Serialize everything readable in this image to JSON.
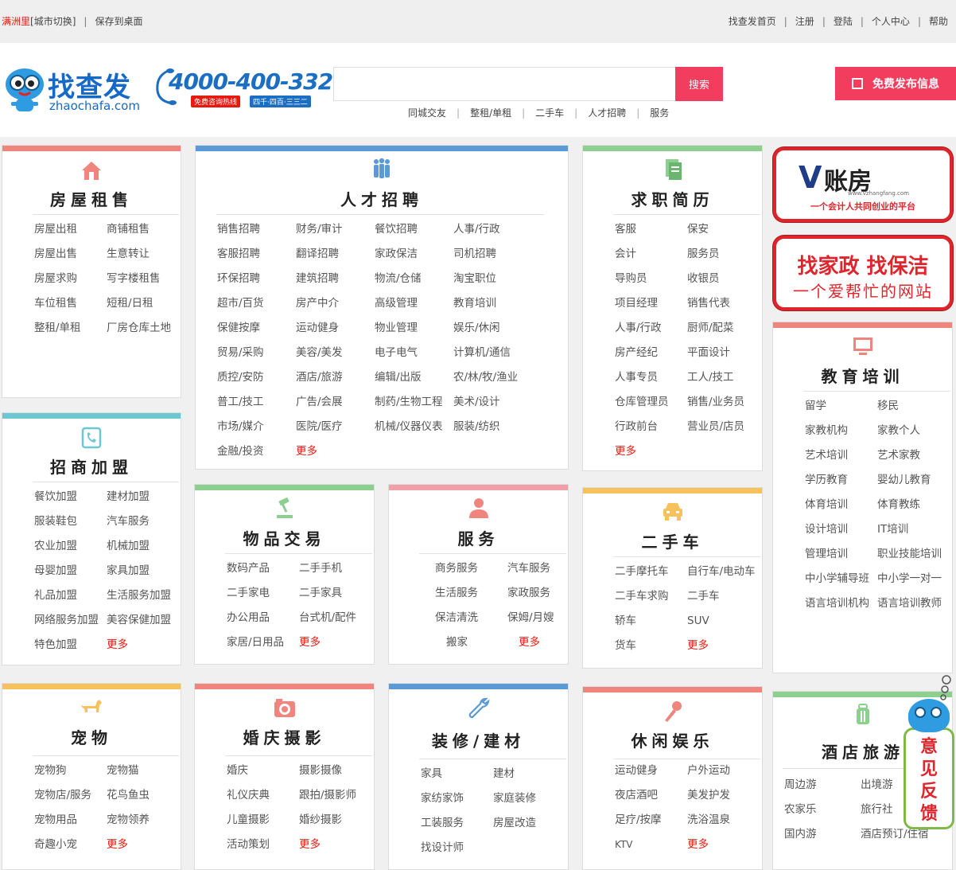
{
  "topbar": {
    "city": "满洲里",
    "city_switch": "[城市切换]",
    "sep": "|",
    "save_desktop": "保存到桌面",
    "links": [
      "找查发首页",
      "注册",
      "登陆",
      "个人中心",
      "帮助"
    ]
  },
  "logo": {
    "text": "找查发",
    "domain": "zhaochafa.com"
  },
  "hotline": {
    "number": "4000-400-332",
    "tag": "免费咨询热线",
    "tag2": "四千·四百·三三二"
  },
  "search": {
    "value": "",
    "placeholder": "",
    "button": "搜索"
  },
  "quick_links": [
    "同城交友",
    "整租/单租",
    "二手车",
    "人才招聘",
    "服务"
  ],
  "publish_button": "免费发布信息",
  "colors": {
    "red": "#f0857e",
    "blue": "#5a9ad6",
    "green": "#8ccf8f",
    "cyan": "#6cc7d3",
    "pink": "#f0a0a6",
    "orange": "#f7c15c",
    "accent": "#f23d5e",
    "more": "#e8190f"
  },
  "panels": {
    "house": {
      "title": "房屋租售",
      "icon": "house-icon",
      "items": [
        "房屋出租",
        "商铺租售",
        "房屋出售",
        "生意转让",
        "房屋求购",
        "写字楼租售",
        "车位租售",
        "短租/日租",
        "整租/单租",
        "厂房仓库土地"
      ]
    },
    "jobs": {
      "title": "人才招聘",
      "icon": "people-icon",
      "items": [
        "销售招聘",
        "财务/审计",
        "餐饮招聘",
        "人事/行政",
        "客服招聘",
        "翻译招聘",
        "家政保洁",
        "司机招聘",
        "环保招聘",
        "建筑招聘",
        "物流/仓储",
        "淘宝职位",
        "超市/百货",
        "房产中介",
        "高级管理",
        "教育培训",
        "保健按摩",
        "运动健身",
        "物业管理",
        "娱乐/休闲",
        "贸易/采购",
        "美容/美发",
        "电子电气",
        "计算机/通信",
        "质控/安防",
        "酒店/旅游",
        "编辑/出版",
        "农/林/牧/渔业",
        "普工/技工",
        "广告/会展",
        "制药/生物工程",
        "美术/设计",
        "市场/媒介",
        "医院/医疗",
        "机械/仪器仪表",
        "服装/纺织",
        "金融/投资"
      ],
      "more": "更多"
    },
    "resume": {
      "title": "求职简历",
      "icon": "resume-icon",
      "items": [
        "客服",
        "保安",
        "会计",
        "服务员",
        "导购员",
        "收银员",
        "项目经理",
        "销售代表",
        "人事/行政",
        "厨师/配菜",
        "房产经纪",
        "平面设计",
        "人事专员",
        "工人/技工",
        "仓库管理员",
        "销售/业务员",
        "行政前台",
        "营业员/店员"
      ],
      "more": "更多"
    },
    "franchise": {
      "title": "招商加盟",
      "icon": "phone-icon",
      "items": [
        "餐饮加盟",
        "建材加盟",
        "服装鞋包",
        "汽车服务",
        "农业加盟",
        "机械加盟",
        "母婴加盟",
        "家具加盟",
        "礼品加盟",
        "生活服务加盟",
        "网络服务加盟",
        "美容保健加盟",
        "特色加盟"
      ],
      "more": "更多"
    },
    "goods": {
      "title": "物品交易",
      "icon": "gavel-icon",
      "items": [
        "数码产品",
        "二手手机",
        "二手家电",
        "二手家具",
        "办公用品",
        "台式机/配件",
        "家居/日用品"
      ],
      "more": "更多"
    },
    "service": {
      "title": "服务",
      "icon": "person-icon",
      "items": [
        "商务服务",
        "汽车服务",
        "生活服务",
        "家政服务",
        "保洁清洗",
        "保姆/月嫂",
        "搬家"
      ],
      "more": "更多"
    },
    "usedcar": {
      "title": "二手车",
      "icon": "car-icon",
      "items": [
        "二手摩托车",
        "自行车/电动车",
        "二手车求购",
        "二手车",
        "轿车",
        "SUV",
        "货车"
      ],
      "more": "更多"
    },
    "education": {
      "title": "教育培训",
      "icon": "monitor-icon",
      "items": [
        "留学",
        "移民",
        "家教机构",
        "家教个人",
        "艺术培训",
        "艺术家教",
        "学历教育",
        "婴幼儿教育",
        "体育培训",
        "体育教练",
        "设计培训",
        "IT培训",
        "管理培训",
        "职业技能培训",
        "中小学辅导班",
        "中小学一对一",
        "语言培训机构",
        "语言培训教师"
      ]
    },
    "pet": {
      "title": "宠物",
      "icon": "dog-icon",
      "items": [
        "宠物狗",
        "宠物猫",
        "宠物店/服务",
        "花鸟鱼虫",
        "宠物用品",
        "宠物领养",
        "奇趣小宠"
      ],
      "more": "更多"
    },
    "wedding": {
      "title": "婚庆摄影",
      "icon": "camera-icon",
      "items": [
        "婚庆",
        "摄影摄像",
        "礼仪庆典",
        "跟拍/摄影师",
        "儿童摄影",
        "婚纱摄影",
        "活动策划"
      ],
      "more": "更多"
    },
    "decor": {
      "title": "装修/建材",
      "icon": "wrench-icon",
      "items": [
        "家具",
        "建材",
        "家纺家饰",
        "家庭装修",
        "工装服务",
        "房屋改造",
        "找设计师"
      ]
    },
    "leisure": {
      "title": "休闲娱乐",
      "icon": "microphone-icon",
      "items": [
        "运动健身",
        "户外运动",
        "夜店酒吧",
        "美发护发",
        "足疗/按摩",
        "洗浴温泉",
        "KTV"
      ],
      "more": "更多"
    },
    "travel": {
      "title": "酒店旅游",
      "icon": "luggage-icon",
      "items": [
        "周边游",
        "出境游",
        "农家乐",
        "旅行社",
        "国内游",
        "酒店预订/住宿"
      ]
    }
  },
  "ads": {
    "zhangfang": {
      "v": "V",
      "big": "账房",
      "url": "www.vzhangfang.com",
      "small": "一个会计人共同创业的平台"
    },
    "jiazheng": {
      "line1": "找家政 找保洁",
      "line2": "一个爱帮忙的网站"
    }
  },
  "feedback": {
    "label": "意见反馈"
  }
}
